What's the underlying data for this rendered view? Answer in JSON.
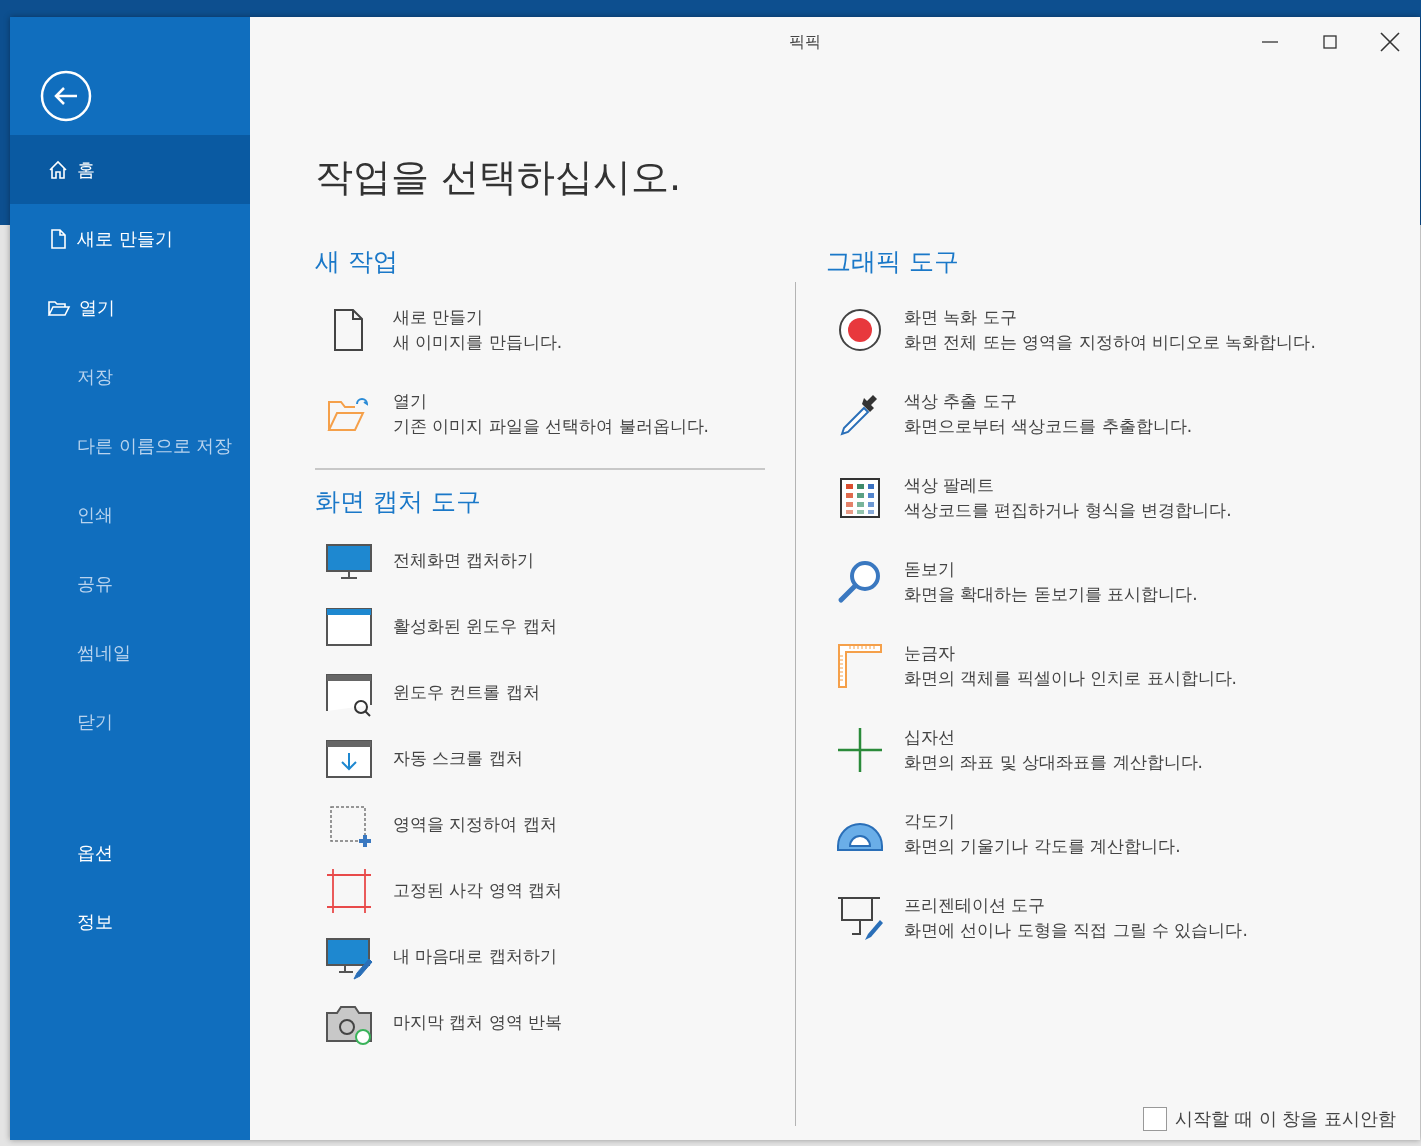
{
  "window": {
    "title": "픽픽"
  },
  "sidebar": {
    "items": [
      {
        "label": "홈",
        "kind": "home",
        "selected": true,
        "disabled": false
      },
      {
        "label": "새로 만들기",
        "kind": "file",
        "selected": false,
        "disabled": false
      },
      {
        "label": "열기",
        "kind": "folder",
        "selected": false,
        "disabled": false
      },
      {
        "label": "저장",
        "kind": "plain",
        "selected": false,
        "disabled": true
      },
      {
        "label": "다른 이름으로 저장",
        "kind": "plain",
        "selected": false,
        "disabled": true
      },
      {
        "label": "인쇄",
        "kind": "plain",
        "selected": false,
        "disabled": true
      },
      {
        "label": "공유",
        "kind": "plain",
        "selected": false,
        "disabled": true
      },
      {
        "label": "썸네일",
        "kind": "plain",
        "selected": false,
        "disabled": true
      },
      {
        "label": "닫기",
        "kind": "plain",
        "selected": false,
        "disabled": true
      }
    ],
    "bottom_items": [
      {
        "label": "옵션",
        "selected": false,
        "disabled": false
      },
      {
        "label": "정보",
        "selected": false,
        "disabled": false
      }
    ]
  },
  "heading": "작업을 선택하십시오.",
  "new_task": {
    "title": "새 작업",
    "items": [
      {
        "title": "새로 만들기",
        "description": "새 이미지를 만듭니다."
      },
      {
        "title": "열기",
        "description": "기존 이미지 파일을 선택하여 불러옵니다."
      }
    ]
  },
  "capture_tools": {
    "title": "화면 캡처 도구",
    "items": [
      {
        "label": "전체화면 캡처하기"
      },
      {
        "label": "활성화된 윈도우 캡처"
      },
      {
        "label": "윈도우 컨트롤 캡처"
      },
      {
        "label": "자동 스크롤 캡처"
      },
      {
        "label": "영역을 지정하여 캡처"
      },
      {
        "label": "고정된 사각 영역 캡처"
      },
      {
        "label": "내 마음대로 캡처하기"
      },
      {
        "label": "마지막 캡처 영역 반복"
      }
    ]
  },
  "graphic_tools": {
    "title": "그래픽 도구",
    "items": [
      {
        "title": "화면 녹화 도구",
        "description": "화면 전체 또는 영역을 지정하여 비디오로 녹화합니다."
      },
      {
        "title": "색상 추출 도구",
        "description": "화면으로부터 색상코드를 추출합니다."
      },
      {
        "title": "색상 팔레트",
        "description": "색상코드를 편집하거나 형식을 변경합니다."
      },
      {
        "title": "돋보기",
        "description": "화면을 확대하는 돋보기를 표시합니다."
      },
      {
        "title": "눈금자",
        "description": "화면의 객체를 픽셀이나 인치로 표시합니다."
      },
      {
        "title": "십자선",
        "description": "화면의 좌표 및 상대좌표를 계산합니다."
      },
      {
        "title": "각도기",
        "description": "화면의 기울기나 각도를 계산합니다."
      },
      {
        "title": "프리젠테이션 도구",
        "description": "화면에 선이나 도형을 직접 그릴 수 있습니다."
      }
    ]
  },
  "startup_option": {
    "label": "시작할 때 이 창을 표시안함",
    "checked": false
  }
}
